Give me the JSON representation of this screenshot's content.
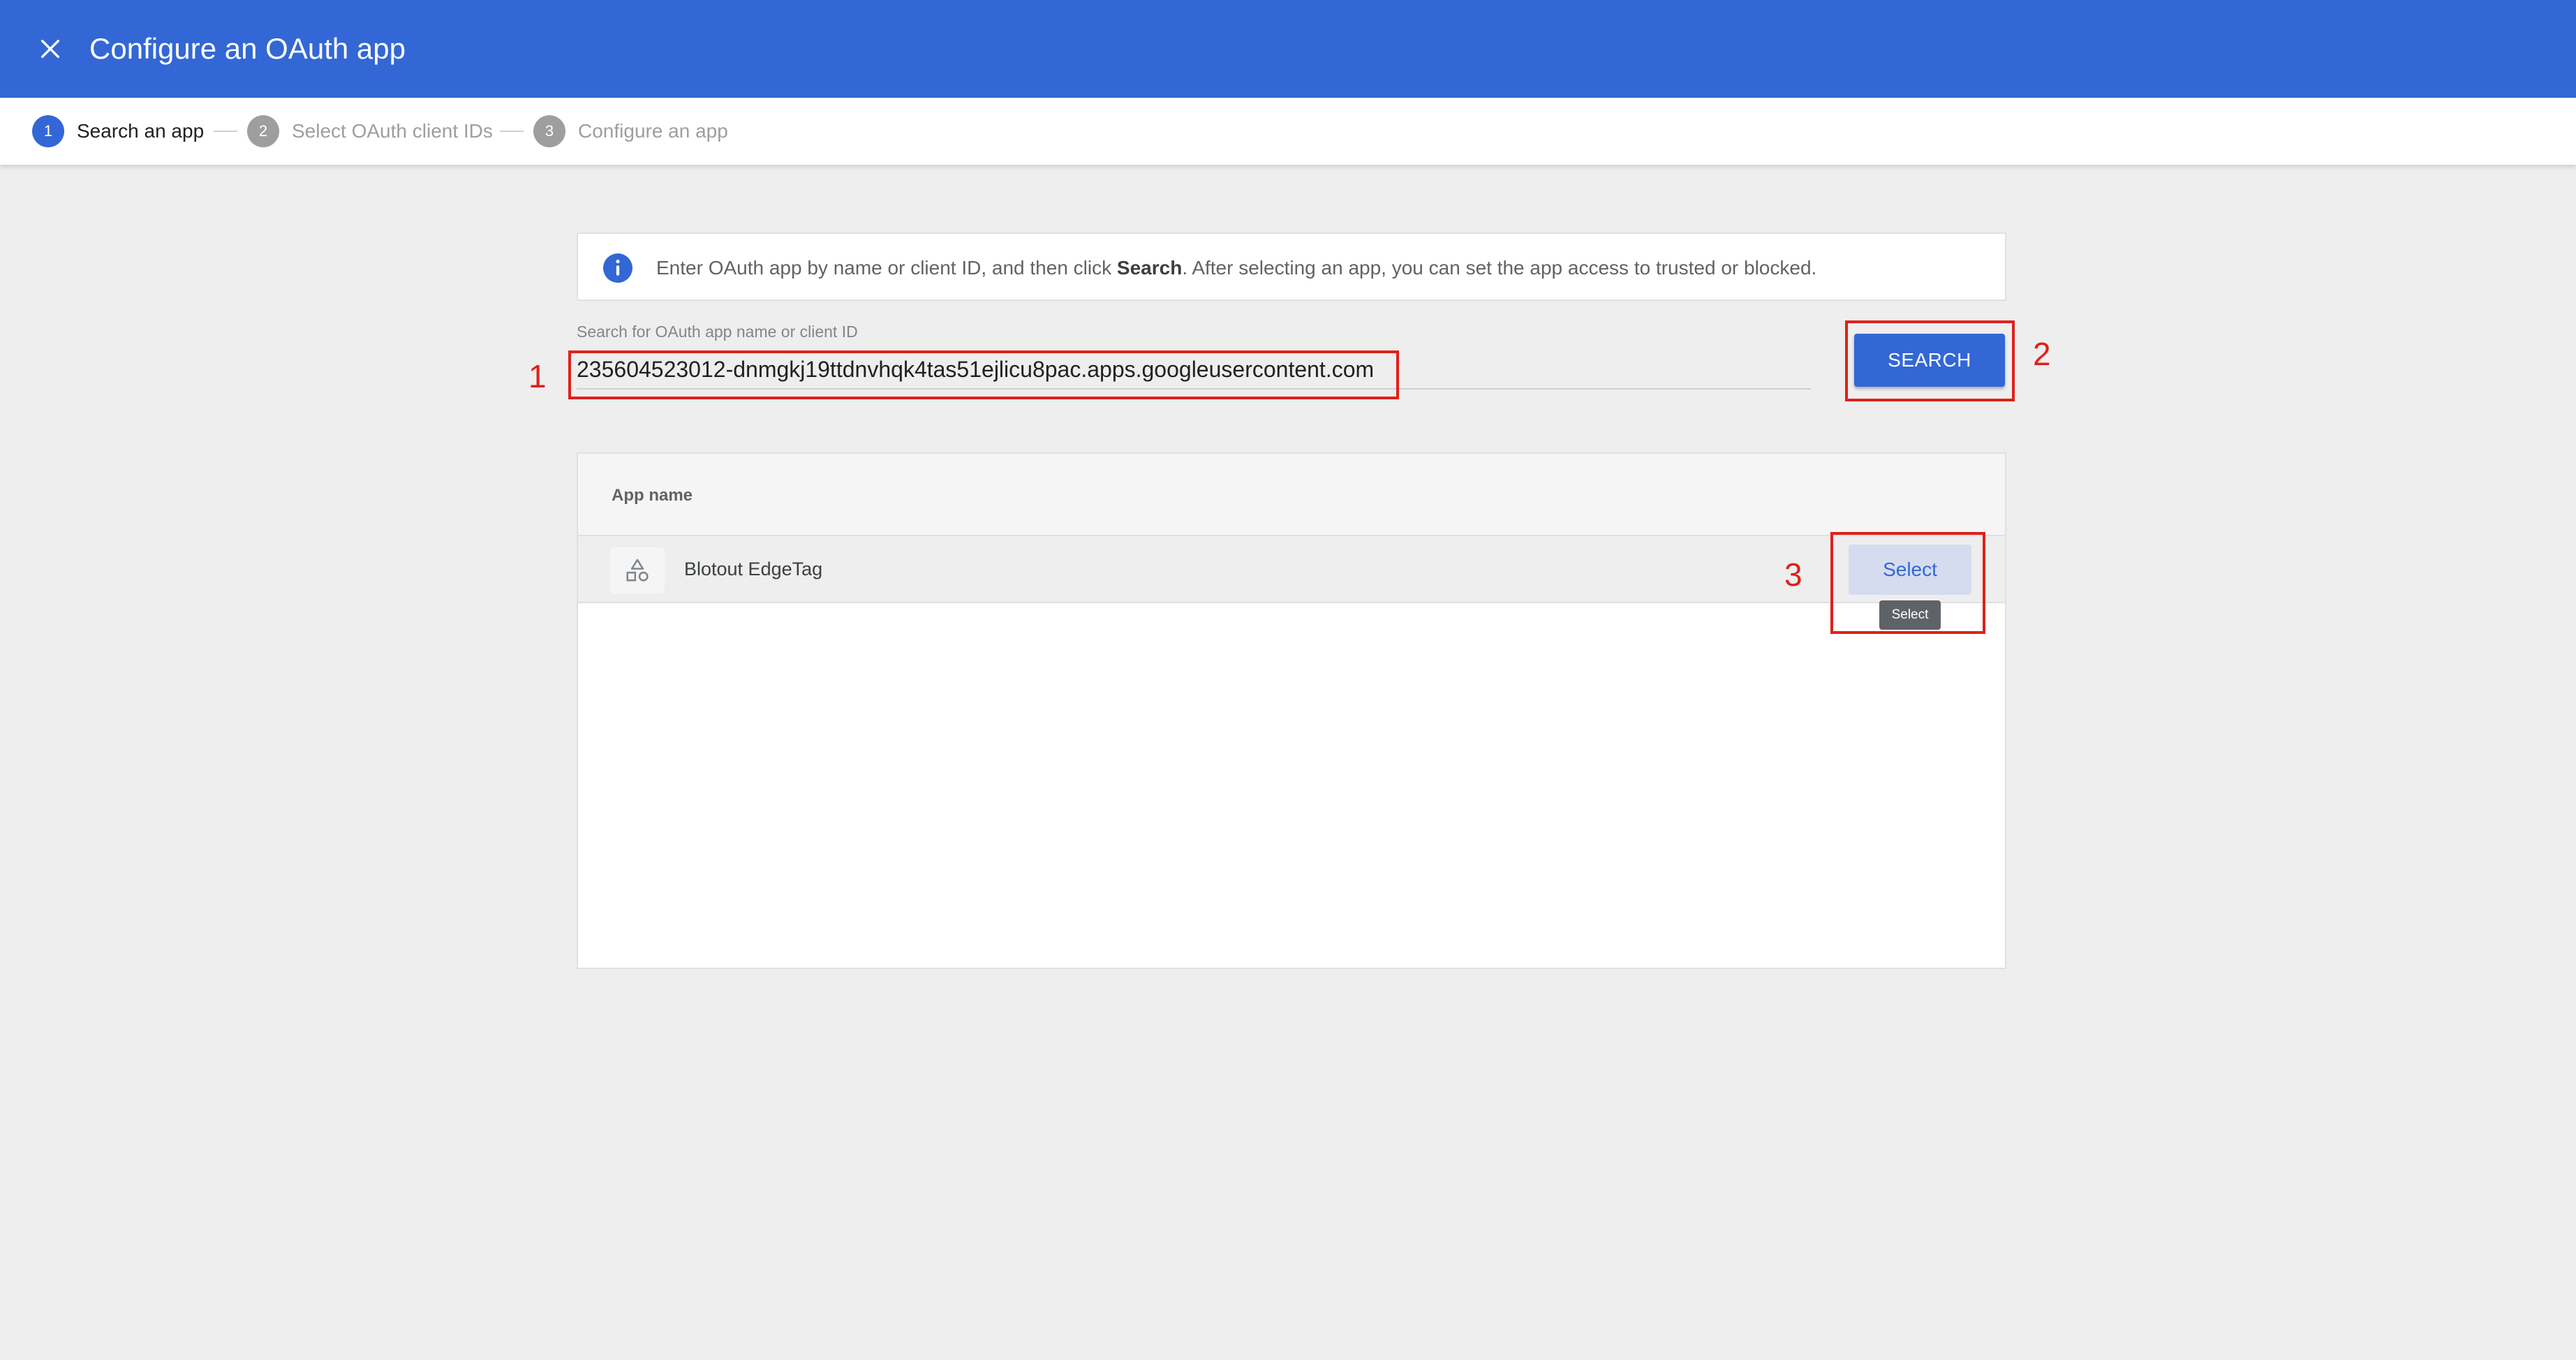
{
  "header": {
    "close_icon": "close-icon",
    "title": "Configure an OAuth app",
    "bg_color": "#3367d6"
  },
  "stepper": {
    "steps": [
      {
        "number": "1",
        "label": "Search an app",
        "state": "active"
      },
      {
        "number": "2",
        "label": "Select OAuth client IDs",
        "state": "inactive"
      },
      {
        "number": "3",
        "label": "Configure an app",
        "state": "inactive"
      }
    ]
  },
  "info": {
    "icon": "info-icon",
    "text_before": "Enter OAuth app by name or client ID, and then click ",
    "text_bold": "Search",
    "text_after": ". After selecting an app, you can set the app access to trusted or blocked."
  },
  "search": {
    "label": "Search for OAuth app name or client ID",
    "value": "235604523012-dnmgkj19ttdnvhqk4tas51ejlicu8pac.apps.googleusercontent.com",
    "button_label": "SEARCH"
  },
  "results": {
    "column_header": "App name",
    "rows": [
      {
        "icon": "shapes-icon",
        "name": "Blotout EdgeTag",
        "action_label": "Select",
        "tooltip": "Select"
      }
    ]
  },
  "annotations": {
    "labels": [
      "1",
      "2",
      "3"
    ],
    "color": "#e0201b"
  }
}
